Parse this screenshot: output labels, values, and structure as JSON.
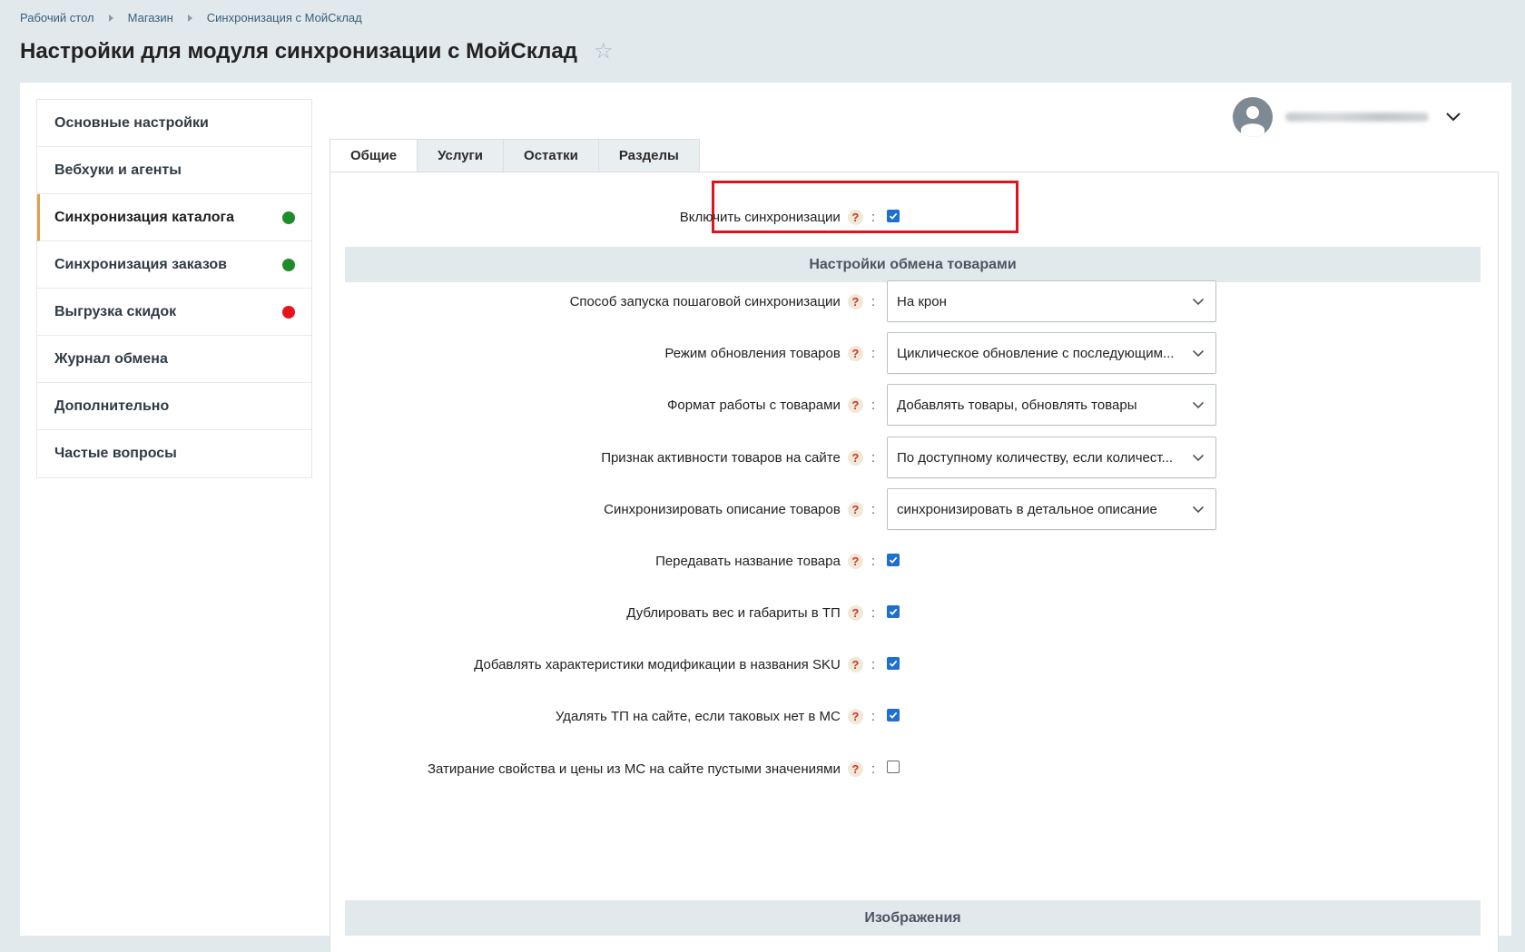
{
  "breadcrumb": [
    "Рабочий стол",
    "Магазин",
    "Синхронизация с МойСклад"
  ],
  "page_title": "Настройки для модуля синхронизации с МойСклад",
  "sidebar": {
    "items": [
      {
        "label": "Основные настройки",
        "status": null,
        "active": false
      },
      {
        "label": "Вебхуки и агенты",
        "status": null,
        "active": false
      },
      {
        "label": "Синхронизация каталога",
        "status": "#1e8c2a",
        "active": true
      },
      {
        "label": "Синхронизация заказов",
        "status": "#1e8c2a",
        "active": false
      },
      {
        "label": "Выгрузка скидок",
        "status": "#e8141c",
        "active": false
      },
      {
        "label": "Журнал обмена",
        "status": null,
        "active": false
      },
      {
        "label": "Дополнительно",
        "status": null,
        "active": false
      },
      {
        "label": "Частые вопросы",
        "status": null,
        "active": false
      }
    ]
  },
  "user": {
    "icon": "user-avatar-icon"
  },
  "tabs": [
    "Общие",
    "Услуги",
    "Остатки",
    "Разделы"
  ],
  "enable_sync": {
    "label": "Включить синхронизации",
    "help": "?",
    "checked": true
  },
  "section_exchange": "Настройки обмена товарами",
  "settings": [
    {
      "label": "Способ запуска пошаговой синхронизации",
      "type": "select",
      "value": "На крон"
    },
    {
      "label": "Режим обновления товаров",
      "type": "select",
      "value": "Циклическое обновление с последующим..."
    },
    {
      "label": "Формат работы с товарами",
      "type": "select",
      "value": "Добавлять товары, обновлять товары"
    },
    {
      "label": "Признак активности товаров на сайте",
      "type": "select",
      "value": "По доступному количеству, если количест..."
    },
    {
      "label": "Синхронизировать описание товаров",
      "type": "select",
      "value": "синхронизировать в детальное описание"
    },
    {
      "label": "Передавать название товара",
      "type": "checkbox",
      "checked": true
    },
    {
      "label": "Дублировать вес и габариты в ТП",
      "type": "checkbox",
      "checked": true
    },
    {
      "label": "Добавлять характеристики модификации в названия SKU",
      "type": "checkbox",
      "checked": true
    },
    {
      "label": "Удалять ТП на сайте, если таковых нет в МС",
      "type": "checkbox",
      "checked": true
    },
    {
      "label": "Затирание свойства и цены из МС на сайте пустыми значениями",
      "type": "checkbox",
      "checked": false
    }
  ],
  "help_glyph": "?",
  "colon": ":",
  "section_images": "Изображения",
  "colors": {
    "accent_blue": "#1d6fd1",
    "highlight_red": "#e2121c",
    "section_bg": "#e2e9ec"
  }
}
